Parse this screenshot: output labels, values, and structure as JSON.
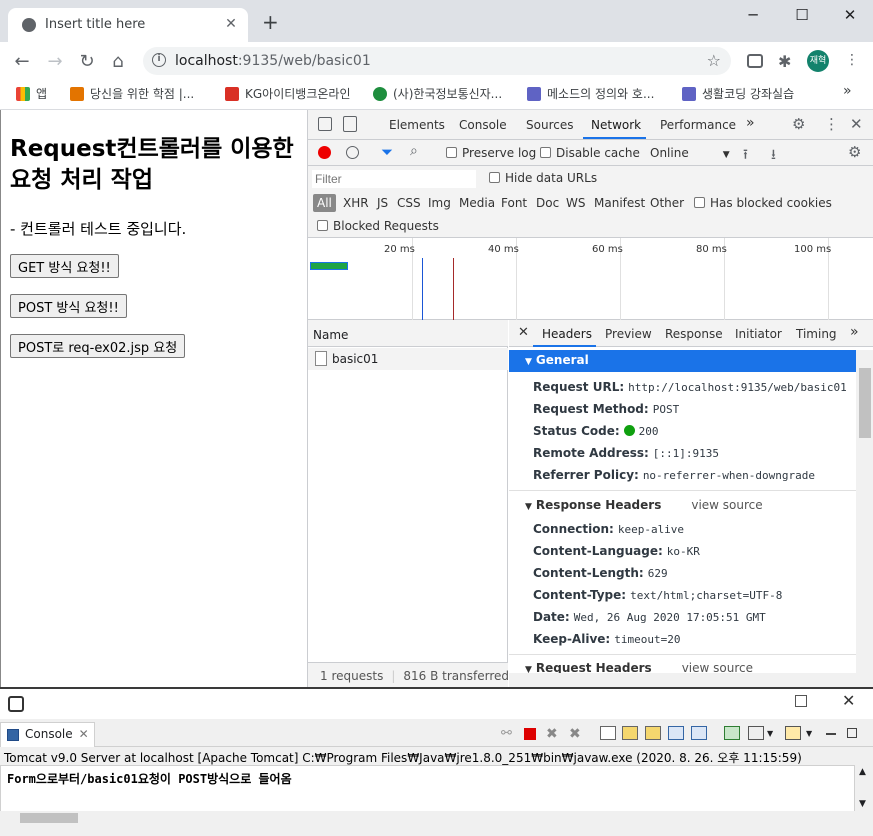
{
  "browser": {
    "tab_title": "Insert title here",
    "close_tab": "✕",
    "new_tab": "+",
    "url_host": "localhost",
    "url_rest": ":9135/web/basic01",
    "avatar": "재혁",
    "window": {
      "minimize": "─",
      "maximize": "☐",
      "close": "✕"
    }
  },
  "bookmarks": [
    {
      "label": "앱",
      "color": "#ea4335"
    },
    {
      "label": "당신을 위한 학점 |...",
      "color": "#e37400"
    },
    {
      "label": "KG아이티뱅크온라인",
      "color": "#d93025"
    },
    {
      "label": "(사)한국정보통신자...",
      "color": "#1e8e3e"
    },
    {
      "label": "메소드의 정의와 호...",
      "color": "#5f63c4"
    },
    {
      "label": "생활코딩 강좌실습",
      "color": "#5f63c4"
    }
  ],
  "page": {
    "heading": "Request컨트롤러를 이용한 요청 처리 작업",
    "description": "- 컨트롤러 테스트 중입니다.",
    "buttons": [
      "GET 방식 요청!!",
      "POST 방식 요청!!",
      "POST로 req-ex02.jsp 요청"
    ]
  },
  "devtools": {
    "tabs": [
      "Elements",
      "Console",
      "Sources",
      "Network",
      "Performance"
    ],
    "active_tab": "Network",
    "preserve_log": "Preserve log",
    "disable_cache": "Disable cache",
    "throttle": "Online",
    "filter_placeholder": "Filter",
    "hide_data_urls": "Hide data URLs",
    "types": [
      "All",
      "XHR",
      "JS",
      "CSS",
      "Img",
      "Media",
      "Font",
      "Doc",
      "WS",
      "Manifest",
      "Other"
    ],
    "has_blocked_cookies": "Has blocked cookies",
    "blocked_requests": "Blocked Requests",
    "timeline_ticks": [
      "20 ms",
      "40 ms",
      "60 ms",
      "80 ms",
      "100 ms"
    ],
    "name_header": "Name",
    "request_name": "basic01",
    "status_requests": "1 requests",
    "status_transferred": "816 B transferred",
    "detail_tabs": [
      "Headers",
      "Preview",
      "Response",
      "Initiator",
      "Timing"
    ],
    "active_detail_tab": "Headers",
    "general_title": "General",
    "general": [
      {
        "k": "Request URL:",
        "v": "http://localhost:9135/web/basic01"
      },
      {
        "k": "Request Method:",
        "v": "POST"
      },
      {
        "k": "Status Code:",
        "v": "200"
      },
      {
        "k": "Remote Address:",
        "v": "[::1]:9135"
      },
      {
        "k": "Referrer Policy:",
        "v": "no-referrer-when-downgrade"
      }
    ],
    "response_headers_title": "Response Headers",
    "request_headers_title": "Request Headers",
    "view_source": "view source",
    "response_headers": [
      {
        "k": "Connection:",
        "v": "keep-alive"
      },
      {
        "k": "Content-Language:",
        "v": "ko-KR"
      },
      {
        "k": "Content-Length:",
        "v": "629"
      },
      {
        "k": "Content-Type:",
        "v": "text/html;charset=UTF-8"
      },
      {
        "k": "Date:",
        "v": "Wed, 26 Aug 2020 17:05:51 GMT"
      },
      {
        "k": "Keep-Alive:",
        "v": "timeout=20"
      }
    ]
  },
  "eclipse": {
    "console_tab": "Console",
    "process": "Tomcat v9.0 Server at localhost [Apache Tomcat] C:₩Program Files₩Java₩jre1.8.0_251₩bin₩javaw.exe (2020. 8. 26. 오후 11:15:59)",
    "output": "Form으로부터/basic01요청이 POST방식으로 들어옴"
  }
}
